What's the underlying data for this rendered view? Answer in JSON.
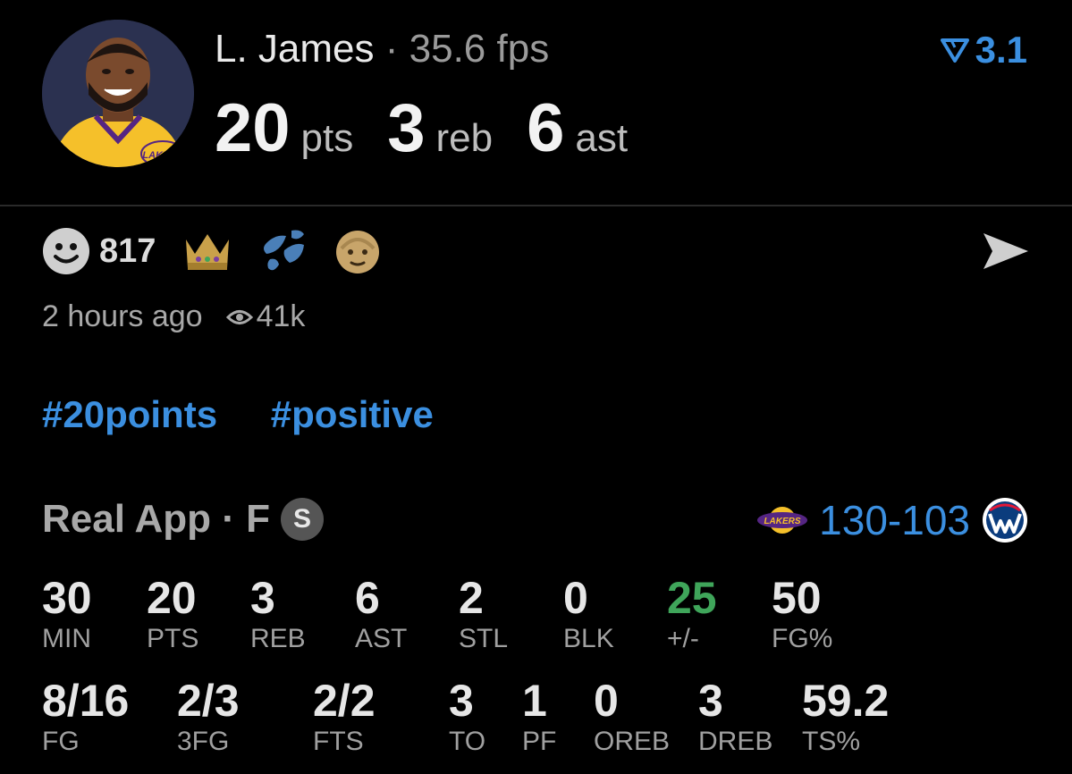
{
  "header": {
    "player_name": "L. James",
    "separator": "·",
    "fps": "35.6 fps",
    "rating": "3.1",
    "stats": [
      {
        "value": "20",
        "unit": "pts"
      },
      {
        "value": "3",
        "unit": "reb"
      },
      {
        "value": "6",
        "unit": "ast"
      }
    ],
    "avatar_logo_text": "LAKERS"
  },
  "reactions": {
    "count": "817",
    "emoji_icons": [
      "crown-icon",
      "sweat-droplets-icon",
      "old-man-face-icon"
    ]
  },
  "meta": {
    "time_ago": "2 hours ago",
    "views": "41k"
  },
  "tags": [
    "#20points",
    "#positive"
  ],
  "source": {
    "label": "Real App · F",
    "badge": "S"
  },
  "score": {
    "home": "130",
    "dash": "-",
    "away": "103",
    "home_logo_text": "LAKERS"
  },
  "box_row1": [
    {
      "value": "30",
      "label": "MIN"
    },
    {
      "value": "20",
      "label": "PTS"
    },
    {
      "value": "3",
      "label": "REB"
    },
    {
      "value": "6",
      "label": "AST"
    },
    {
      "value": "2",
      "label": "STL"
    },
    {
      "value": "0",
      "label": "BLK"
    },
    {
      "value": "25",
      "label": "+/-"
    },
    {
      "value": "50",
      "label": "FG%"
    }
  ],
  "box_row2": [
    {
      "value": "8/16",
      "label": "FG"
    },
    {
      "value": "2/3",
      "label": "3FG"
    },
    {
      "value": "2/2",
      "label": "FTS"
    },
    {
      "value": "3",
      "label": "TO"
    },
    {
      "value": "1",
      "label": "PF"
    },
    {
      "value": "0",
      "label": "OREB"
    },
    {
      "value": "3",
      "label": "DREB"
    },
    {
      "value": "59.2",
      "label": "TS%"
    }
  ],
  "colors": {
    "accent_blue": "#3b8fe0",
    "positive_green": "#3fa55a",
    "lakers_gold": "#f5c02a",
    "lakers_purple": "#552583"
  }
}
